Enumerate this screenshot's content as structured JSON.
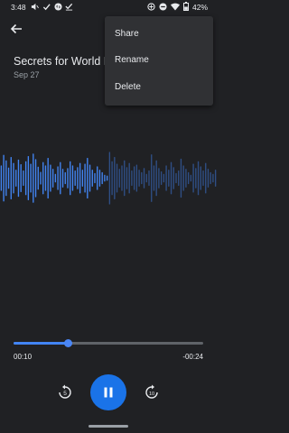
{
  "status_bar": {
    "time": "3:48",
    "battery": "42%"
  },
  "recording": {
    "title": "Secrets for World D",
    "date": "Sep 27"
  },
  "menu": {
    "items": [
      "Share",
      "Rename",
      "Delete"
    ]
  },
  "player": {
    "elapsed": "00:10",
    "remaining": "-00:24",
    "progress": 0.29
  },
  "waveform": {
    "played_color": "#4285f4",
    "unplayed_color": "#2f4f86",
    "played_fraction": 0.5,
    "levels": [
      0.3,
      0.55,
      0.42,
      0.25,
      0.5,
      0.36,
      0.2,
      0.44,
      0.33,
      0.18,
      0.4,
      0.52,
      0.34,
      0.58,
      0.45,
      0.27,
      0.15,
      0.38,
      0.3,
      0.48,
      0.32,
      0.22,
      0.1,
      0.28,
      0.38,
      0.22,
      0.14,
      0.24,
      0.4,
      0.3,
      0.18,
      0.26,
      0.36,
      0.2,
      0.34,
      0.48,
      0.32,
      0.2,
      0.12,
      0.28,
      0.2,
      0.14,
      0.08,
      0.06,
      0.62,
      0.4,
      0.5,
      0.34,
      0.22,
      0.3,
      0.42,
      0.26,
      0.36,
      0.18,
      0.28,
      0.32,
      0.2,
      0.14,
      0.24,
      0.1,
      0.18,
      0.56,
      0.3,
      0.42,
      0.24,
      0.16,
      0.1,
      0.3,
      0.2,
      0.38,
      0.26,
      0.12,
      0.18,
      0.46,
      0.3,
      0.22,
      0.14,
      0.08,
      0.34,
      0.24,
      0.4,
      0.28,
      0.18,
      0.36,
      0.22,
      0.14,
      0.1,
      0.2
    ]
  },
  "colors": {
    "background": "#202124",
    "accent": "#1a73e8",
    "menu_bg": "#303134"
  }
}
